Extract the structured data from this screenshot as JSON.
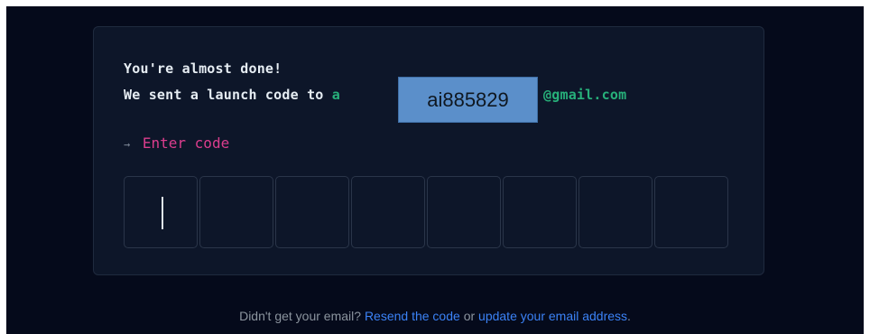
{
  "card": {
    "heading": "You're almost done!",
    "sent_prefix": "We sent a launch code to",
    "email_user_visible": "a",
    "email_domain": "@gmail.com",
    "redaction_label": "ai885829",
    "prompt_arrow": "→",
    "prompt_label": "Enter code",
    "code_digits": [
      "",
      "",
      "",
      "",
      "",
      "",
      "",
      ""
    ]
  },
  "footer": {
    "question": "Didn't get your email?",
    "resend_link": "Resend the code",
    "or_text": "or",
    "update_link": "update your email address",
    "period": "."
  },
  "colors": {
    "background": "#050a1b",
    "card": "#0d1629",
    "email_green": "#27b07a",
    "prompt_pink": "#db3d8d",
    "link_blue": "#3b82f6"
  }
}
